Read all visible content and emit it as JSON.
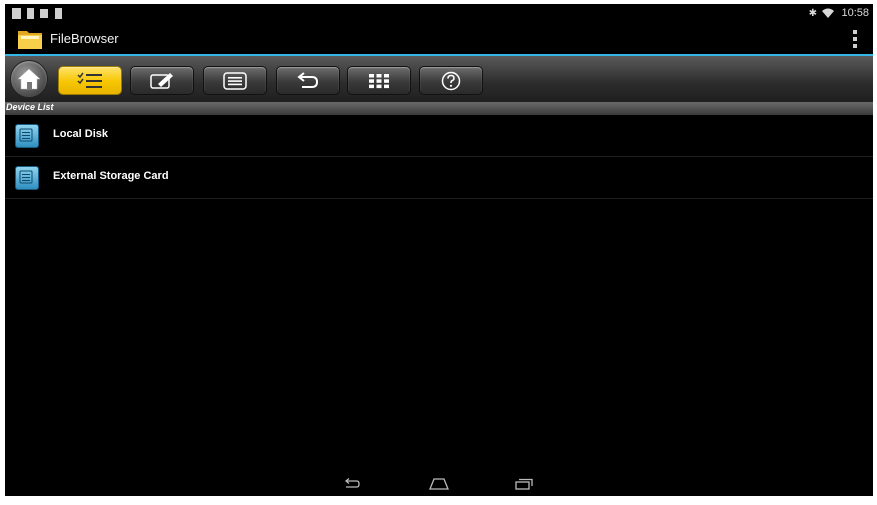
{
  "status_bar": {
    "time": "10:58",
    "left_icons": [
      "notification-icon",
      "sd-card-icon",
      "download-icon",
      "screenshot-icon"
    ],
    "right_icons": [
      "bluetooth-icon",
      "wifi-icon"
    ]
  },
  "action_bar": {
    "title": "FileBrowser",
    "app_icon": "folder-icon",
    "overflow_icon": "overflow-menu-icon"
  },
  "toolbar": {
    "buttons": [
      {
        "icon": "home-icon"
      },
      {
        "icon": "checklist-icon",
        "active": true
      },
      {
        "icon": "edit-icon"
      },
      {
        "icon": "list-icon"
      },
      {
        "icon": "back-arrow-icon"
      },
      {
        "icon": "grid-icon"
      },
      {
        "icon": "help-icon"
      }
    ]
  },
  "device_list": {
    "header": "Device List",
    "items": [
      {
        "label": "Local Disk",
        "icon": "storage-device-icon"
      },
      {
        "label": "External Storage Card",
        "icon": "storage-device-icon"
      }
    ]
  },
  "nav_bar": {
    "buttons": [
      "back-nav-icon",
      "home-nav-icon",
      "recent-apps-icon"
    ]
  },
  "colors": {
    "accent": "#33b5e5",
    "active_button": "#f7c600",
    "background": "#000000"
  }
}
